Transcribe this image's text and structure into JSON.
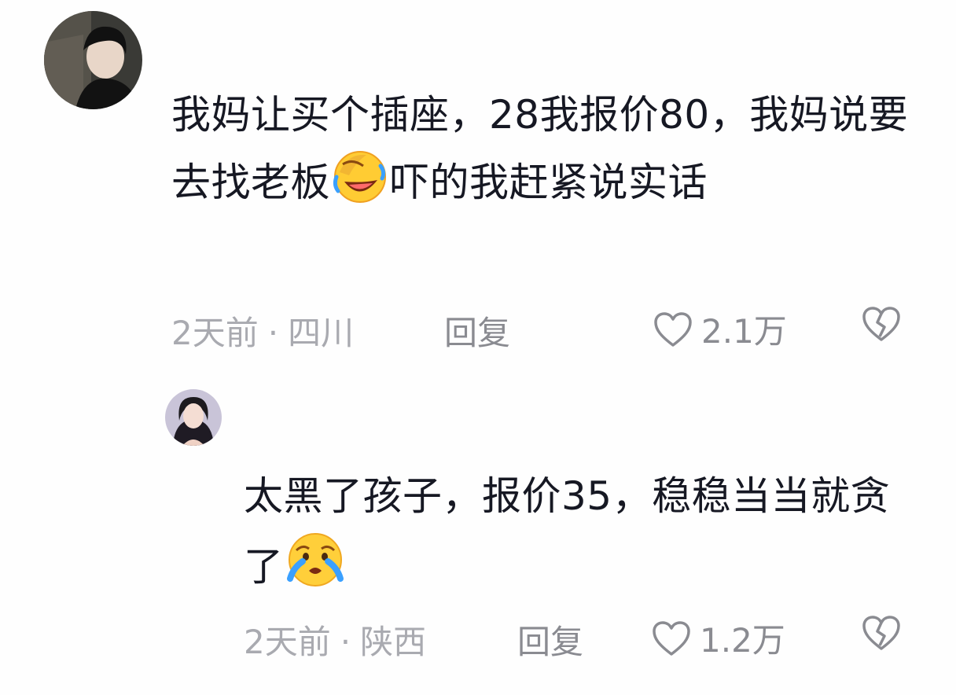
{
  "comments": [
    {
      "text_before": "我妈让买个插座，28我报价80，我妈说要去找老板",
      "emoji": "rofl-emoji",
      "text_after": "吓的我赶紧说实话",
      "time": "2天前",
      "separator": "·",
      "location": "四川",
      "reply_label": "回复",
      "likes": "2.1万"
    },
    {
      "text_before": "太黑了孩子，报价35，稳稳当当就贪了",
      "emoji": "crying-emoji",
      "text_after": "",
      "time": "2天前",
      "separator": "·",
      "location": "陕西",
      "reply_label": "回复",
      "likes": "1.2万"
    }
  ],
  "colors": {
    "text": "#161823",
    "meta": "#a9aab0",
    "action": "#8a8b91"
  }
}
